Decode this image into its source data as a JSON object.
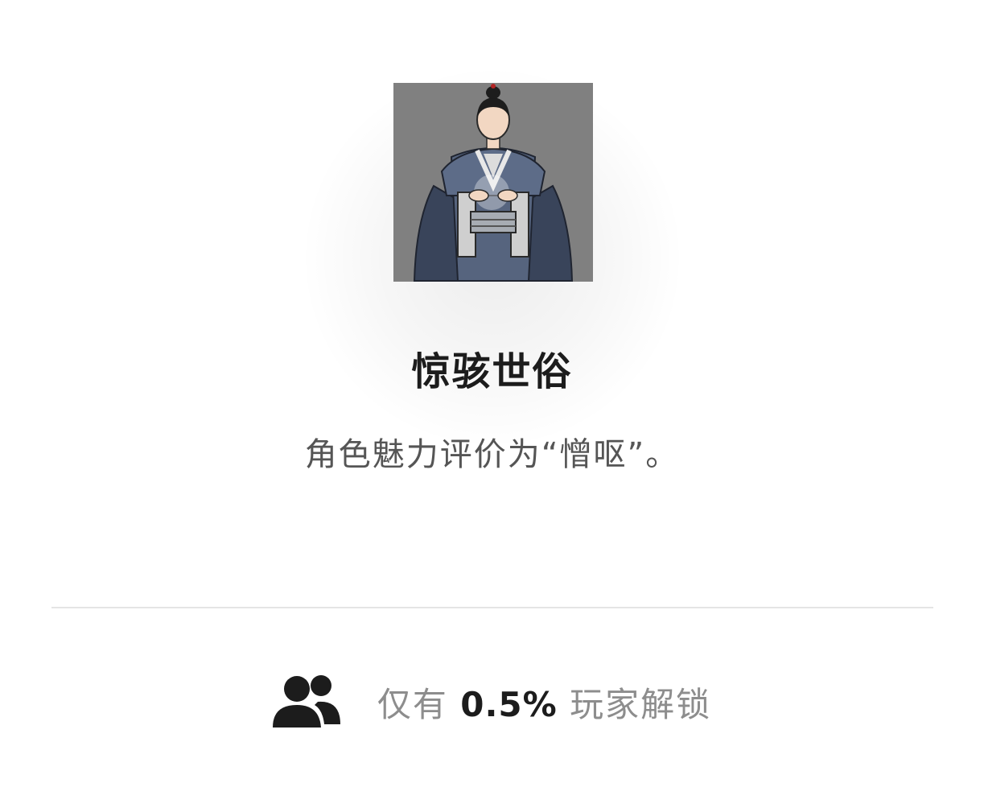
{
  "achievement": {
    "icon": "robed-scholar-portrait",
    "title": "惊骇世俗",
    "description": "角色魅力评价为“憎呕”。"
  },
  "stats": {
    "icon": "users-icon",
    "prefix": "仅有",
    "percent": "0.5%",
    "suffix": "玩家解锁"
  },
  "colors": {
    "background": "#ffffff",
    "title": "#1c1c1c",
    "description": "#555555",
    "muted": "#8d8d8d",
    "divider": "#e5e5e5",
    "icon_background": "#808080"
  }
}
